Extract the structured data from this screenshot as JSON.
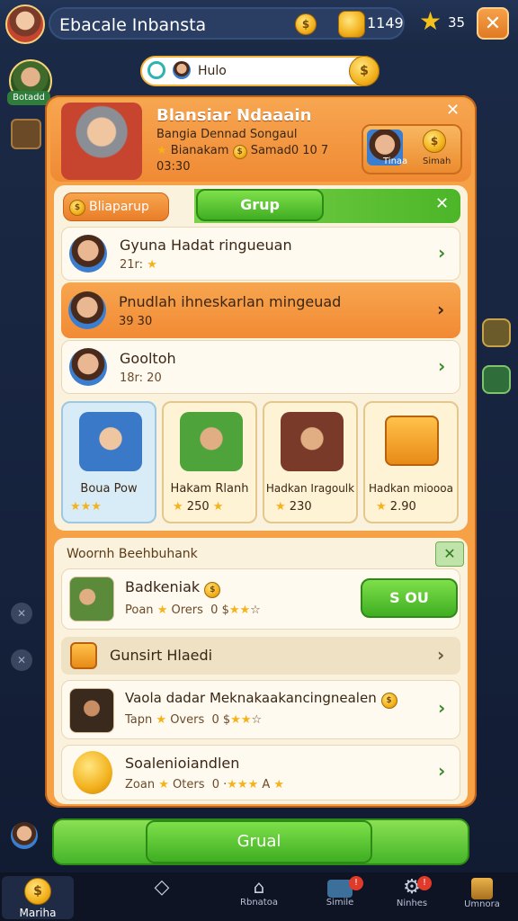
{
  "topbar": {
    "title": "Ebacale Inbansta",
    "coins_value": "1149",
    "stars_value": "35",
    "close_label": "✕"
  },
  "search": {
    "value": "Hulo"
  },
  "side_left": {
    "profile_label": "Botadd"
  },
  "header": {
    "name": "Blansiar Ndaaain",
    "subtitle": "Bangia Dennad Songaul",
    "meta_a": "Bianakam",
    "meta_b": "Samad0 10 7",
    "time": "03:30",
    "card_label_a": "Tinaa",
    "card_label_b": "Simah",
    "close_label": "✕"
  },
  "groups": {
    "chip_label": "Bliaparup",
    "tab_label": "Grup",
    "close_label": "✕",
    "rows": [
      {
        "title": "Gyuna Hadat ringueuan",
        "sub": "21r:"
      },
      {
        "title": "Pnudlah ihneskarlan mingeuad",
        "sub": "39 30"
      },
      {
        "title": "Gooltoh",
        "sub": "18r: 20"
      }
    ]
  },
  "rewards": [
    {
      "title": "Boua Pow",
      "value": ""
    },
    {
      "title": "Hakam Rlanh",
      "value": "250"
    },
    {
      "title": "Hadkan Iragoulk",
      "value": "230"
    },
    {
      "title": "Hadkan mioooa",
      "value": "2.90"
    }
  ],
  "members": {
    "heading": "Woornh Beehbuhank",
    "close_label": "✕",
    "first": {
      "title": "Badkeniak",
      "sub_a": "Poan",
      "sub_b": "Orers",
      "sub_c": "0 $",
      "button_label": "S OU"
    },
    "section_label": "Gunsirt Hlaedi",
    "rows": [
      {
        "title": "Vaola dadar Meknakaakancingnealen",
        "sub_a": "Tapn",
        "sub_b": "Overs",
        "sub_c": "0 $"
      },
      {
        "title": "Soalenioiandlen",
        "sub_a": "Zoan",
        "sub_b": "Oters",
        "sub_c": "0 ·"
      }
    ]
  },
  "main_button_label": "Grual",
  "nav": [
    {
      "label": "Mariha",
      "icon": "coin-icon"
    },
    {
      "label": "",
      "icon": "diamond-icon"
    },
    {
      "label": "Rbnatoa",
      "icon": "house-icon"
    },
    {
      "label": "Simile",
      "icon": "chat-icon",
      "badge": "!"
    },
    {
      "label": "Ninhes",
      "icon": "gear-icon",
      "badge": "!"
    },
    {
      "label": "Umnora",
      "icon": "chest-icon"
    }
  ],
  "colors": {
    "accent": "#f28a34",
    "green": "#3fae22",
    "panel": "#fbf2dd"
  }
}
